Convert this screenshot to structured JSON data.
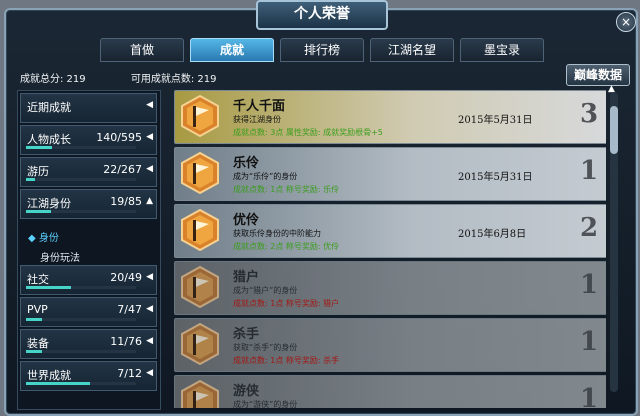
{
  "window": {
    "title": "个人荣誉",
    "close_glyph": "×"
  },
  "tabs": [
    {
      "label": "首做",
      "active": false
    },
    {
      "label": "成就",
      "active": true
    },
    {
      "label": "排行榜",
      "active": false
    },
    {
      "label": "江湖名望",
      "active": false
    },
    {
      "label": "墨宝录",
      "active": false
    }
  ],
  "summary": {
    "total_label": "成就总分: 219",
    "available_label": "可用成就点数: 219"
  },
  "peak_button": "巅峰数据",
  "sidebar": {
    "items": [
      {
        "label": "近期成就",
        "count": "",
        "progress": null,
        "arrow": "◀"
      },
      {
        "label": "人物成长",
        "count": "140/595",
        "progress": 0.235,
        "arrow": "◀"
      },
      {
        "label": "游历",
        "count": "22/267",
        "progress": 0.082,
        "arrow": "◀"
      },
      {
        "label": "江湖身份",
        "count": "19/85",
        "progress": 0.224,
        "arrow": "▲"
      },
      {
        "label": "社交",
        "count": "20/49",
        "progress": 0.408,
        "arrow": "◀"
      },
      {
        "label": "PVP",
        "count": "7/47",
        "progress": 0.149,
        "arrow": "◀"
      },
      {
        "label": "装备",
        "count": "11/76",
        "progress": 0.145,
        "arrow": "◀"
      },
      {
        "label": "世界成就",
        "count": "7/12",
        "progress": 0.583,
        "arrow": "◀"
      }
    ],
    "subitems": [
      {
        "label": "◆   身份",
        "selected": true
      },
      {
        "label": "身份玩法",
        "selected": false
      }
    ]
  },
  "achievements": [
    {
      "title": "千人千面",
      "desc": "获得江湖身份",
      "reward": "成就点数: 3点 属性奖励: 成就奖励根骨+5",
      "date": "2015年5月31日",
      "number": "3",
      "style": "gold"
    },
    {
      "title": "乐伶",
      "desc": "成为“乐伶”的身份",
      "reward": "成就点数: 1点 称号奖励: 乐伶",
      "date": "2015年5月31日",
      "number": "1",
      "style": "silver"
    },
    {
      "title": "优伶",
      "desc": "获取乐伶身份的中阶能力",
      "reward": "成就点数: 2点 称号奖励: 优伶",
      "date": "2015年6月8日",
      "number": "2",
      "style": "silver"
    },
    {
      "title": "猎户",
      "desc": "成为“猎户”的身份",
      "reward": "成就点数: 1点 称号奖励: 猎户",
      "date": "",
      "number": "1",
      "style": "dim"
    },
    {
      "title": "杀手",
      "desc": "获取“杀手”的身份",
      "reward": "成就点数: 1点 称号奖励: 杀手",
      "date": "",
      "number": "1",
      "style": "dim"
    },
    {
      "title": "游侠",
      "desc": "成为“游侠”的身份",
      "reward": "",
      "date": "",
      "number": "1",
      "style": "dim"
    }
  ],
  "colors": {
    "accent": "#55b7e6",
    "progress": "#46d4c8",
    "reward_ok": "#3a9d1c",
    "reward_locked": "#c2160f"
  },
  "icons": {
    "badge": "hexagon-flag-icon",
    "close": "close-icon",
    "scroll_up": "triangle-up-icon"
  }
}
